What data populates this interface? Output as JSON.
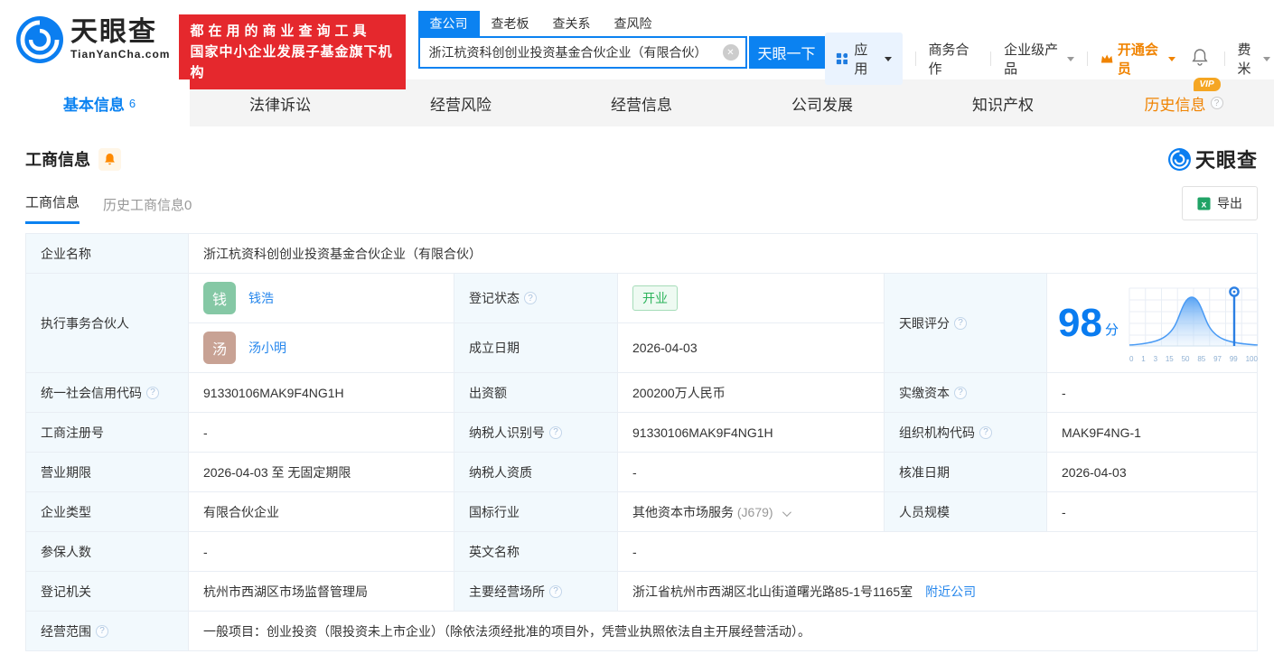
{
  "header": {
    "brand": "天眼查",
    "brand_domain": "TianYanCha.com",
    "promo_line1": "都在用的商业查询工具",
    "promo_line2": "国家中小企业发展子基金旗下机构",
    "search": {
      "tab_company": "查公司",
      "tab_boss": "查老板",
      "tab_relation": "查关系",
      "tab_risk": "查风险",
      "value": "浙江杭资科创创业投资基金合伙企业（有限合伙）",
      "button": "天眼一下"
    },
    "nav": {
      "apps": "应用",
      "cooperation": "商务合作",
      "enterprise_products": "企业级产品",
      "vip": "开通会员",
      "username": "费米"
    }
  },
  "tabs": {
    "basic": "基本信息",
    "basic_count": "6",
    "legal": "法律诉讼",
    "risk": "经营风险",
    "operation": "经营信息",
    "development": "公司发展",
    "ip": "知识产权",
    "history": "历史信息",
    "history_vip": "VIP"
  },
  "section": {
    "title": "工商信息",
    "watermark": "天眼查",
    "subtab_active": "工商信息",
    "subtab_history": "历史工商信息",
    "subtab_history_count": "0",
    "export_label": "导出"
  },
  "info": {
    "company_name_label": "企业名称",
    "company_name": "浙江杭资科创创业投资基金合伙企业（有限合伙）",
    "partners_label": "执行事务合伙人",
    "partner1_avatar": "钱",
    "partner1_name": "钱浩",
    "partner2_avatar": "汤",
    "partner2_name": "汤小明",
    "reg_status_label": "登记状态",
    "reg_status": "开业",
    "est_date_label": "成立日期",
    "est_date": "2026-04-03",
    "score_label": "天眼评分",
    "uscc_label": "统一社会信用代码",
    "uscc": "91330106MAK9F4NG1H",
    "contribution_label": "出资额",
    "contribution": "200200万人民币",
    "paidin_label": "实缴资本",
    "paidin": "-",
    "regno_label": "工商注册号",
    "regno": "-",
    "taxid_label": "纳税人识别号",
    "taxid": "91330106MAK9F4NG1H",
    "orgcode_label": "组织机构代码",
    "orgcode": "MAK9F4NG-1",
    "term_label": "营业期限",
    "term": "2026-04-03 至 无固定期限",
    "tax_qual_label": "纳税人资质",
    "tax_qual": "-",
    "approve_date_label": "核准日期",
    "approve_date": "2026-04-03",
    "type_label": "企业类型",
    "type": "有限合伙企业",
    "industry_label": "国标行业",
    "industry": "其他资本市场服务",
    "industry_code": "(J679)",
    "staff_label": "人员规模",
    "staff": "-",
    "insured_label": "参保人数",
    "insured": "-",
    "eng_name_label": "英文名称",
    "eng_name": "-",
    "reg_authority_label": "登记机关",
    "reg_authority": "杭州市西湖区市场监督管理局",
    "address_label": "主要经营场所",
    "address": "浙江省杭州市西湖区北山街道曙光路85-1号1165室",
    "nearby_link": "附近公司",
    "scope_label": "经营范围",
    "scope": "一般项目：创业投资（限投资未上市企业）（除依法须经批准的项目外，凭营业执照依法自主开展经营活动）。"
  },
  "score_chart": {
    "type": "area",
    "score": "98",
    "unit": "分",
    "ticks": [
      "0",
      "1",
      "3",
      "15",
      "50",
      "85",
      "97",
      "99",
      "100"
    ],
    "marker_value": 98,
    "accent_color": "#2b7fe3",
    "description": "percentile bell curve with marker at score 98"
  }
}
